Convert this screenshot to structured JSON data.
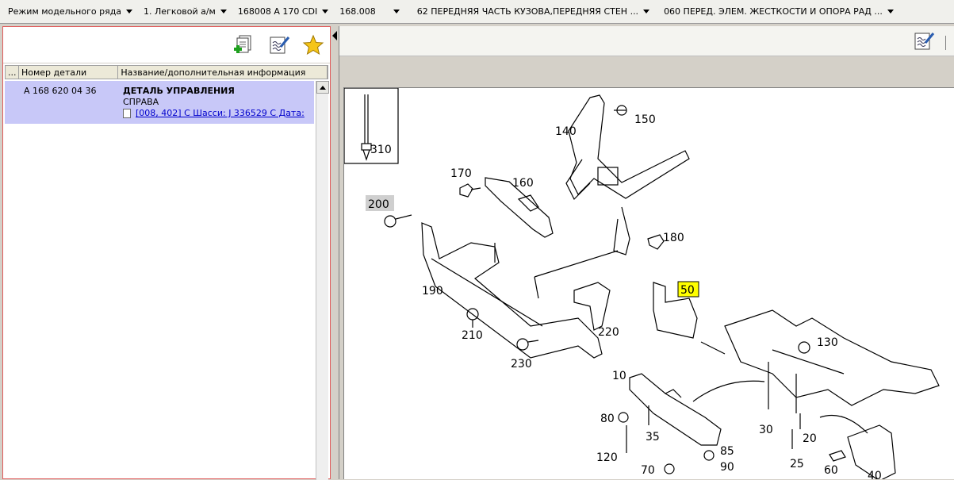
{
  "breadcrumbs": [
    {
      "label": "Режим модельного ряда"
    },
    {
      "label": "1. Легковой а/м"
    },
    {
      "label": "168008 A 170 CDI"
    },
    {
      "label": "168.008"
    },
    {
      "label": "62 ПЕРЕДНЯЯ ЧАСТЬ КУЗОВА,ПЕРЕДНЯЯ СТЕН ..."
    },
    {
      "label": "060 ПЕРЕД. ЭЛЕМ. ЖЕСТКОСТИ И ОПОРА РАД ..."
    }
  ],
  "left_toolbar": {
    "icons": [
      "add-document-icon",
      "edit-notes-icon",
      "favorite-star-icon"
    ]
  },
  "grid": {
    "headers": [
      "...",
      "Номер детали",
      "Название/дополнительная информация"
    ],
    "rows": [
      {
        "part_number": "A 168 620 04 36",
        "name": "ДЕТАЛЬ УПРАВЛЕНИЯ",
        "side": "СПРАВА",
        "info_link": "[008, 402] С Шасси: J 336529 С Дата:"
      }
    ]
  },
  "drawing": {
    "highlight_color": "#ffff00",
    "labels": {
      "p310": "310",
      "p150": "150",
      "p140": "140",
      "p170": "170",
      "p160": "160",
      "p200": "200",
      "p180": "180",
      "p190": "190",
      "p50": "50",
      "p210": "210",
      "p220": "220",
      "p230": "230",
      "p130": "130",
      "p10": "10",
      "p80": "80",
      "p35": "35",
      "p30": "30",
      "p20": "20",
      "p120": "120",
      "p85": "85",
      "p90": "90",
      "p25": "25",
      "p70": "70",
      "p60": "60",
      "p40": "40"
    }
  }
}
